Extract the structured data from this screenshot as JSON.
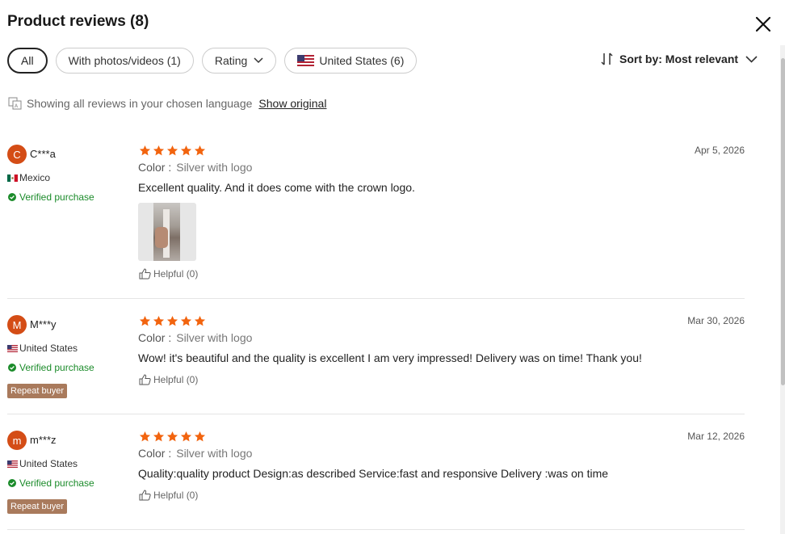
{
  "header": {
    "title": "Product reviews (8)"
  },
  "filters": {
    "all": "All",
    "photos": "With photos/videos (1)",
    "rating": "Rating",
    "country": "United States (6)"
  },
  "sort": {
    "label": "Sort by: Most relevant"
  },
  "language": {
    "notice": "Showing all reviews in your chosen language",
    "link": "Show original"
  },
  "colors": {
    "accent": "#d44d16",
    "star": "#f2640f",
    "verified": "#1b8b2a",
    "repeat_badge": "#a97a5c"
  },
  "reviews": [
    {
      "initial": "C",
      "user": "C***a",
      "country": "Mexico",
      "verified": "Verified purchase",
      "rating": 5,
      "date": "Apr 5, 2026",
      "color_key": "Color :",
      "color_value": "Silver with logo",
      "text": "Excellent quality. And it does come with the crown logo.",
      "helpful": "Helpful (0)"
    },
    {
      "initial": "M",
      "user": "M***y",
      "country": "United States",
      "verified": "Verified purchase",
      "badge": "Repeat buyer",
      "rating": 5,
      "date": "Mar 30, 2026",
      "color_key": "Color :",
      "color_value": "Silver with logo",
      "text": "Wow! it's beautiful and the quality is excellent I am very impressed! Delivery was on time! Thank you!",
      "helpful": "Helpful (0)"
    },
    {
      "initial": "m",
      "user": "m***z",
      "country": "United States",
      "verified": "Verified purchase",
      "badge": "Repeat buyer",
      "rating": 5,
      "date": "Mar 12, 2026",
      "color_key": "Color :",
      "color_value": "Silver with logo",
      "text": "Quality:quality product Design:as described Service:fast and responsive Delivery :was on time",
      "helpful": "Helpful (0)"
    }
  ]
}
